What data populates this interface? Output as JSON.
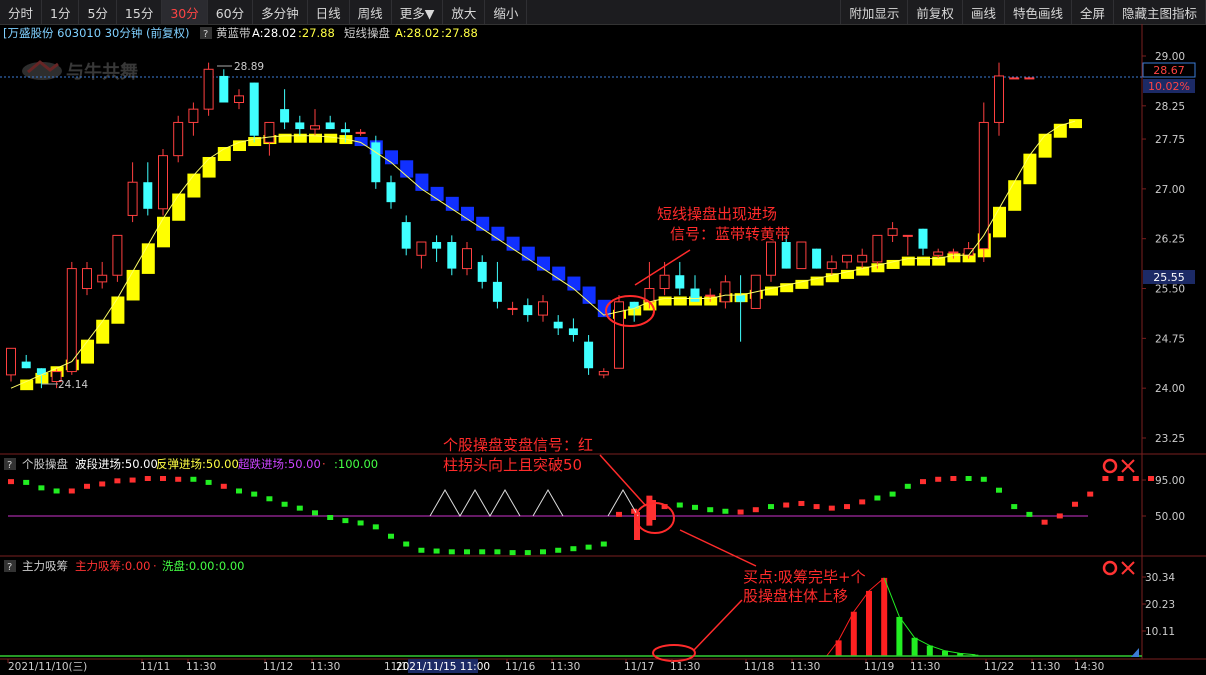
{
  "toolbar": {
    "left": [
      "分时",
      "1分",
      "5分",
      "15分",
      "30分",
      "60分",
      "多分钟",
      "日线",
      "周线",
      "更多▼",
      "放大",
      "缩小"
    ],
    "active": "30分",
    "right": [
      "附加显示",
      "前复权",
      "画线",
      "特色画线",
      "全屏",
      "隐藏主图指标"
    ]
  },
  "main_legend": {
    "stock": "[万盛股份 603010 30分钟 (前复权)",
    "q": "?",
    "ind1": "黄蓝带",
    "ind1_a": "A:28.02",
    "ind1_b": ":27.88",
    "ind2": "短线操盘",
    "ind2_a": "A:28.02",
    "ind2_b": ":27.88"
  },
  "watermark": "与牛共舞",
  "price_axis": {
    "ticks": [
      "29.00",
      "28.25",
      "27.75",
      "27.00",
      "26.25",
      "25.50",
      "24.75",
      "24.00",
      "23.25"
    ],
    "current_price": "28.67",
    "current_pct": "10.02%",
    "box_price": "25.55"
  },
  "annotations": {
    "high_label": "28.89",
    "low_label": "24.14",
    "entry_signal_line1": "短线操盘出现进场",
    "entry_signal_line2": "信号：蓝带转黄带",
    "turn_signal_line1": "个股操盘变盘信号：红",
    "turn_signal_line2": "柱拐头向上且突破50",
    "buy_point_line1": "买点:吸筹完毕+个",
    "buy_point_line2": "股操盘柱体上移"
  },
  "panel2": {
    "q": "?",
    "title": "个股操盘",
    "l1": "波段进场:50.00",
    "l2": "反弹进场:50.00",
    "l3": "超跌进场:50.00",
    "l4": "·",
    "l5": ":100.00",
    "ticks": [
      "95.00",
      "50.00"
    ]
  },
  "panel3": {
    "q": "?",
    "title": "主力吸筹",
    "l1": "主力吸筹:0.00",
    "l2": "·",
    "l3": "洗盘:0.00",
    "l4": ":0.00",
    "ticks": [
      "30.34",
      "20.23",
      "10.11"
    ]
  },
  "time_axis": {
    "labels": [
      "2021/11/10(三)",
      "11/11",
      "11:30",
      "11/12",
      "11:30",
      "11/15",
      "11/16",
      "11:30",
      "11/17",
      "11:30",
      "11/18",
      "11:30",
      "11/19",
      "11:30",
      "11/22",
      "11:30",
      "14:30"
    ],
    "cursor_label": "2021/11/15 11:00"
  },
  "chart_data": {
    "type": "candlestick",
    "series_candles": [
      [
        24.2,
        24.6,
        24.1,
        24.6
      ],
      [
        24.4,
        24.5,
        24.3,
        24.3
      ],
      [
        24.3,
        24.3,
        24.0,
        24.2
      ],
      [
        24.1,
        24.3,
        24.0,
        24.25
      ],
      [
        24.25,
        25.9,
        24.2,
        25.8
      ],
      [
        25.5,
        25.9,
        25.4,
        25.8
      ],
      [
        25.6,
        25.9,
        25.5,
        25.7
      ],
      [
        25.7,
        26.3,
        25.6,
        26.3
      ],
      [
        26.6,
        27.4,
        26.5,
        27.1
      ],
      [
        27.1,
        27.4,
        26.6,
        26.7
      ],
      [
        26.7,
        27.6,
        26.6,
        27.5
      ],
      [
        27.5,
        28.1,
        27.4,
        28.0
      ],
      [
        28.0,
        28.3,
        27.8,
        28.2
      ],
      [
        28.2,
        28.9,
        28.1,
        28.8
      ],
      [
        28.7,
        28.8,
        28.3,
        28.3
      ],
      [
        28.3,
        28.5,
        28.2,
        28.4
      ],
      [
        28.6,
        28.6,
        27.7,
        27.8
      ],
      [
        27.7,
        28.0,
        27.5,
        28.0
      ],
      [
        28.2,
        28.5,
        27.9,
        28.0
      ],
      [
        28.0,
        28.1,
        27.8,
        27.9
      ],
      [
        27.9,
        28.2,
        27.8,
        27.95
      ],
      [
        28.0,
        28.1,
        27.9,
        27.9
      ],
      [
        27.9,
        28.0,
        27.7,
        27.85
      ],
      [
        27.85,
        27.9,
        27.8,
        27.85
      ],
      [
        27.7,
        27.8,
        27.0,
        27.1
      ],
      [
        27.1,
        27.2,
        26.7,
        26.8
      ],
      [
        26.5,
        26.6,
        26.0,
        26.1
      ],
      [
        26.0,
        26.2,
        25.8,
        26.2
      ],
      [
        26.2,
        26.3,
        25.9,
        26.1
      ],
      [
        26.2,
        26.3,
        25.7,
        25.8
      ],
      [
        25.8,
        26.2,
        25.7,
        26.1
      ],
      [
        25.9,
        26.0,
        25.5,
        25.6
      ],
      [
        25.6,
        25.9,
        25.2,
        25.3
      ],
      [
        25.2,
        25.3,
        25.1,
        25.2
      ],
      [
        25.25,
        25.35,
        25.0,
        25.1
      ],
      [
        25.1,
        25.4,
        25.0,
        25.3
      ],
      [
        25.0,
        25.1,
        24.8,
        24.9
      ],
      [
        24.9,
        25.05,
        24.7,
        24.8
      ],
      [
        24.7,
        24.8,
        24.2,
        24.3
      ],
      [
        24.2,
        24.3,
        24.15,
        24.25
      ],
      [
        24.3,
        25.4,
        24.3,
        25.3
      ],
      [
        25.3,
        25.3,
        25.0,
        25.2
      ],
      [
        25.3,
        25.9,
        25.2,
        25.5
      ],
      [
        25.5,
        25.9,
        25.4,
        25.7
      ],
      [
        25.7,
        25.9,
        25.4,
        25.5
      ],
      [
        25.5,
        25.7,
        25.3,
        25.3
      ],
      [
        25.4,
        25.5,
        25.3,
        25.4
      ],
      [
        25.3,
        25.7,
        25.2,
        25.6
      ],
      [
        25.4,
        25.7,
        24.7,
        25.3
      ],
      [
        25.2,
        25.7,
        25.2,
        25.7
      ],
      [
        25.7,
        26.2,
        25.6,
        26.2
      ],
      [
        26.2,
        26.3,
        25.8,
        25.8
      ],
      [
        25.8,
        26.2,
        25.8,
        26.2
      ],
      [
        26.1,
        26.1,
        25.8,
        25.8
      ],
      [
        25.8,
        26.0,
        25.7,
        25.9
      ],
      [
        25.9,
        26.0,
        25.8,
        26.0
      ],
      [
        25.9,
        26.1,
        25.8,
        26.0
      ],
      [
        25.9,
        26.3,
        25.8,
        26.3
      ],
      [
        26.3,
        26.5,
        26.2,
        26.4
      ],
      [
        26.3,
        26.3,
        26.0,
        26.3
      ],
      [
        26.4,
        26.4,
        26.0,
        26.1
      ],
      [
        26.0,
        26.1,
        25.95,
        26.05
      ],
      [
        26.05,
        26.1,
        25.95,
        26.05
      ],
      [
        26.0,
        26.2,
        25.95,
        26.1
      ],
      [
        26.1,
        28.3,
        25.9,
        28.0
      ],
      [
        28.0,
        28.9,
        27.8,
        28.7
      ],
      [
        28.67,
        28.67,
        28.67,
        28.67
      ],
      [
        28.67,
        28.67,
        28.67,
        28.67
      ]
    ],
    "band_values": [
      24.0,
      24.1,
      24.2,
      24.3,
      24.4,
      24.7,
      25.0,
      25.35,
      25.75,
      26.15,
      26.55,
      26.9,
      27.2,
      27.45,
      27.6,
      27.7,
      27.75,
      27.78,
      27.8,
      27.8,
      27.8,
      27.78,
      27.75,
      27.7,
      27.55,
      27.4,
      27.2,
      27.0,
      26.85,
      26.7,
      26.55,
      26.4,
      26.25,
      26.1,
      25.95,
      25.8,
      25.65,
      25.5,
      25.3,
      25.1,
      25.15,
      25.2,
      25.3,
      25.35,
      25.35,
      25.35,
      25.35,
      25.4,
      25.4,
      25.45,
      25.5,
      25.55,
      25.6,
      25.65,
      25.7,
      25.75,
      25.8,
      25.85,
      25.9,
      25.95,
      25.95,
      25.95,
      26.0,
      26.0,
      26.3,
      26.7,
      27.1,
      27.5,
      27.8,
      27.95,
      28.02
    ],
    "band_blue_segment": [
      23,
      39
    ],
    "panel2_values": [
      96,
      95,
      88,
      84,
      84,
      90,
      93,
      97,
      98,
      100,
      100,
      99,
      99,
      95,
      90,
      84,
      80,
      74,
      67,
      62,
      56,
      50,
      46,
      43,
      38,
      26,
      16,
      8,
      7,
      6,
      6,
      6,
      6,
      5,
      5,
      6,
      8,
      10,
      12,
      16,
      54,
      58,
      62,
      64,
      66,
      63,
      60,
      58,
      57,
      60,
      64,
      66,
      68,
      64,
      62,
      64,
      70,
      75,
      80,
      90,
      96,
      99,
      100,
      100,
      99,
      85,
      64,
      54,
      44,
      52,
      67,
      80,
      100,
      100,
      100,
      100
    ],
    "panel2_green_idx": [
      1,
      2,
      3,
      12,
      13,
      15,
      16,
      17,
      18,
      19,
      20,
      21,
      22,
      23,
      24,
      25,
      26,
      27,
      28,
      29,
      30,
      31,
      32,
      33,
      34,
      35,
      36,
      37,
      38,
      39,
      44,
      45,
      46,
      47,
      50,
      57,
      58,
      59,
      63,
      64,
      65,
      66,
      67
    ],
    "panel3_red_idx": [
      53,
      54,
      55,
      56
    ],
    "panel3_values": [
      0,
      0,
      0,
      0,
      0,
      0,
      0,
      0,
      0,
      0,
      0,
      0,
      0,
      0,
      0,
      0,
      0,
      0,
      0,
      0,
      0,
      0,
      0,
      0,
      0,
      0,
      0,
      0,
      0,
      0,
      0,
      0,
      0,
      0,
      0,
      0,
      0,
      0,
      0,
      0,
      0,
      0,
      0,
      0,
      0,
      0,
      0,
      0,
      0,
      0,
      0,
      0,
      0,
      6,
      17,
      25,
      30,
      15,
      7,
      4,
      2,
      1,
      0.5,
      0,
      0,
      0,
      0,
      0
    ],
    "ylim": [
      23.0,
      29.4
    ]
  }
}
